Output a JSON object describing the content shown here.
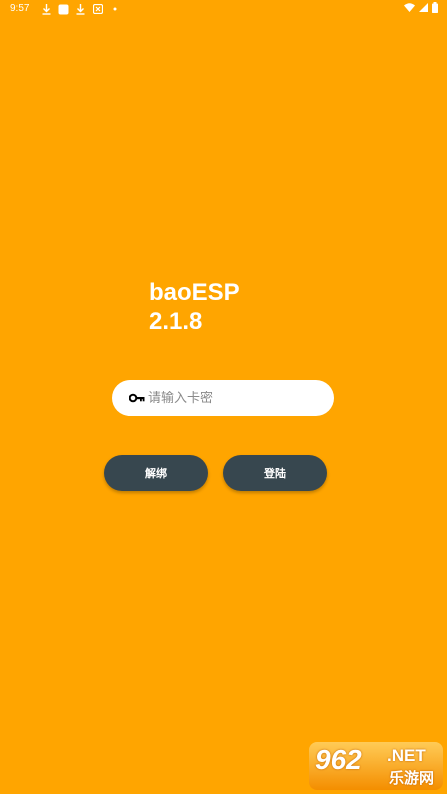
{
  "status_bar": {
    "time": "9:57",
    "left_icons": [
      "download-icon",
      "app-square-icon",
      "download-icon",
      "close-box-icon",
      "dot-icon"
    ],
    "right_icons": [
      "wifi-icon",
      "signal-icon",
      "battery-icon"
    ]
  },
  "app": {
    "name": "baoESP",
    "version": "2.1.8"
  },
  "login_form": {
    "code_placeholder": "请输入卡密",
    "code_value": "",
    "unbind_label": "解绑",
    "login_label": "登陆"
  },
  "watermark": {
    "number": "962",
    "suffix": ".NET",
    "cn_text": "乐游网"
  },
  "colors": {
    "background": "#FFA500",
    "button": "#37474F",
    "input_bg": "#FFFFFF"
  }
}
